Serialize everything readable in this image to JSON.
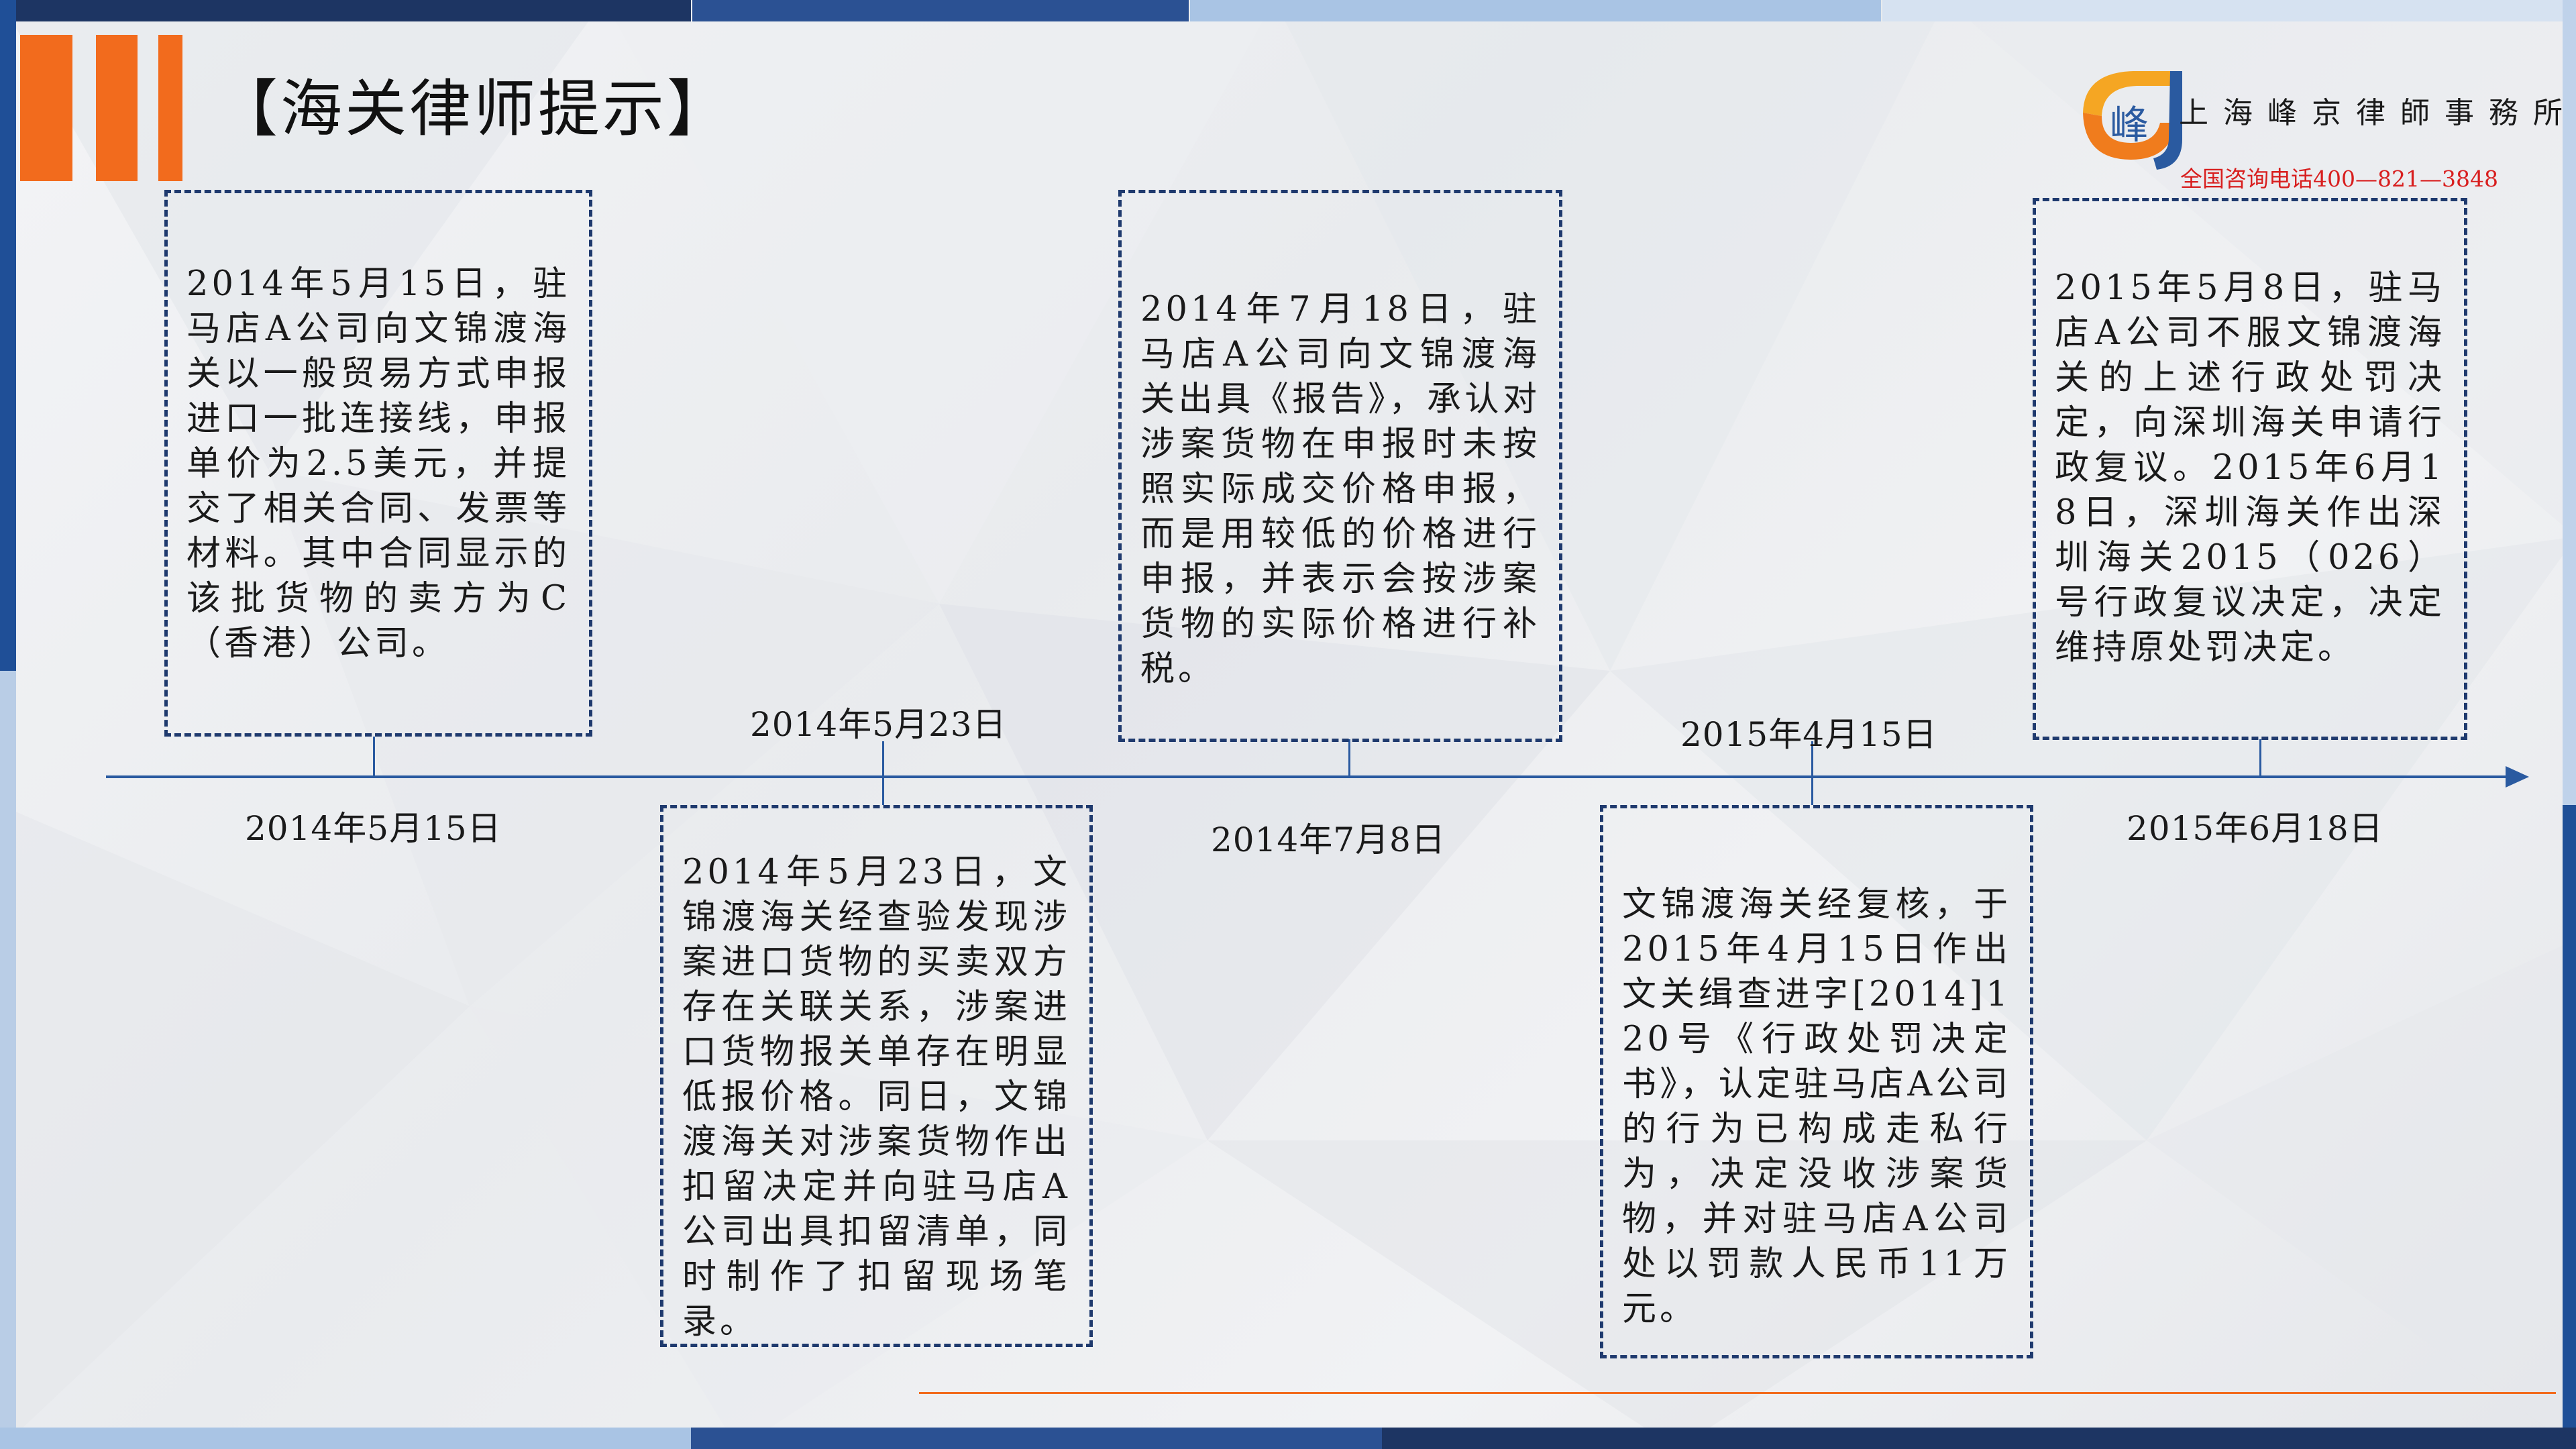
{
  "title": "【海关律师提示】",
  "firm": {
    "name": "上海峰京律師事務所",
    "phone": "全国咨询电话400—821—3848",
    "logo_char": "峰"
  },
  "colors": {
    "accent_orange": "#f26b1d",
    "navy": "#1f3a6e",
    "axis_blue": "#2a5aa0",
    "phone_red": "#d81e1e"
  },
  "timeline": {
    "events": [
      {
        "date": "2014年5月15日",
        "text": "2014年5月15日，驻马店A公司向文锦渡海关以一般贸易方式申报进口一批连接线，申报单价为2.5美元，并提交了相关合同、发票等材料。其中合同显示的该批货物的卖方为C（香港）公司。"
      },
      {
        "date": "2014年5月23日",
        "text": "2014年5月23日，文锦渡海关经查验发现涉案进口货物的买卖双方存在关联关系，涉案进口货物报关单存在明显低报价格。同日，文锦渡海关对涉案货物作出扣留决定并向驻马店A公司出具扣留清单，同时制作了扣留现场笔录。"
      },
      {
        "date": "2014年7月8日",
        "text": "2014年7月18日，驻马店A公司向文锦渡海关出具《报告》，承认对涉案货物在申报时未按照实际成交价格申报，而是用较低的价格进行申报，并表示会按涉案货物的实际价格进行补税。"
      },
      {
        "date": "2015年4月15日",
        "text": "文锦渡海关经复核，于2015年4月15日作出文关缉查进字[2014]120号《行政处罚决定书》，认定驻马店A公司的行为已构成走私行为，决定没收涉案货物，并对驻马店A公司处以罚款人民币11万元。"
      },
      {
        "date": "2015年6月18日",
        "text": "2015年5月8日，驻马店A公司不服文锦渡海关的上述行政处罚决定，向深圳海关申请行政复议。2015年6月18日，深圳海关作出深圳海关2015（026）号行政复议决定，决定维持原处罚决定。"
      }
    ]
  }
}
